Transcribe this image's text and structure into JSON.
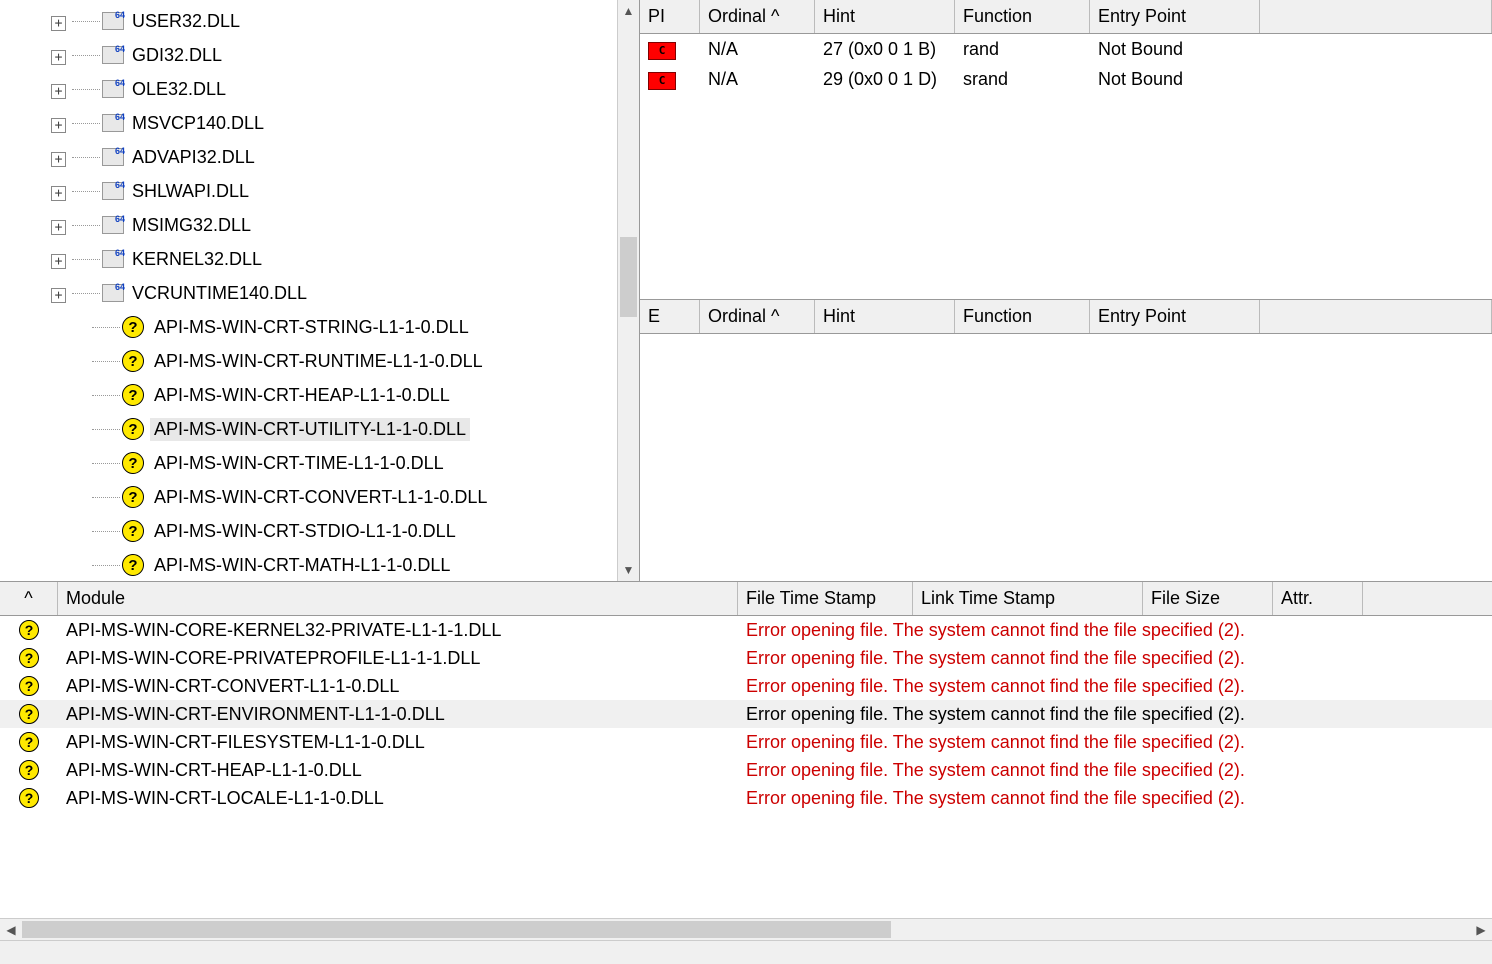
{
  "tree": {
    "nodes": [
      {
        "type": "mod",
        "label": "USER32.DLL",
        "expandable": true,
        "indent": 1
      },
      {
        "type": "mod",
        "label": "GDI32.DLL",
        "expandable": true,
        "indent": 1
      },
      {
        "type": "mod",
        "label": "OLE32.DLL",
        "expandable": true,
        "indent": 1
      },
      {
        "type": "mod",
        "label": "MSVCP140.DLL",
        "expandable": true,
        "indent": 1
      },
      {
        "type": "mod",
        "label": "ADVAPI32.DLL",
        "expandable": true,
        "indent": 1
      },
      {
        "type": "mod",
        "label": "SHLWAPI.DLL",
        "expandable": true,
        "indent": 1
      },
      {
        "type": "mod",
        "label": "MSIMG32.DLL",
        "expandable": true,
        "indent": 1
      },
      {
        "type": "mod",
        "label": "KERNEL32.DLL",
        "expandable": true,
        "indent": 1
      },
      {
        "type": "mod",
        "label": "VCRUNTIME140.DLL",
        "expandable": true,
        "indent": 1
      },
      {
        "type": "q",
        "label": "API-MS-WIN-CRT-STRING-L1-1-0.DLL",
        "indent": 2
      },
      {
        "type": "q",
        "label": "API-MS-WIN-CRT-RUNTIME-L1-1-0.DLL",
        "indent": 2
      },
      {
        "type": "q",
        "label": "API-MS-WIN-CRT-HEAP-L1-1-0.DLL",
        "indent": 2
      },
      {
        "type": "q",
        "label": "API-MS-WIN-CRT-UTILITY-L1-1-0.DLL",
        "indent": 2,
        "selected": true
      },
      {
        "type": "q",
        "label": "API-MS-WIN-CRT-TIME-L1-1-0.DLL",
        "indent": 2
      },
      {
        "type": "q",
        "label": "API-MS-WIN-CRT-CONVERT-L1-1-0.DLL",
        "indent": 2
      },
      {
        "type": "q",
        "label": "API-MS-WIN-CRT-STDIO-L1-1-0.DLL",
        "indent": 2
      },
      {
        "type": "q",
        "label": "API-MS-WIN-CRT-MATH-L1-1-0.DLL",
        "indent": 2,
        "last": true
      }
    ]
  },
  "imports": {
    "headers": [
      "PI",
      "Ordinal ^",
      "Hint",
      "Function",
      "Entry Point",
      ""
    ],
    "rows": [
      {
        "badge": "C",
        "ordinal": "N/A",
        "hint": "27 (0x0 0 1 B)",
        "func": "rand",
        "entry": "Not Bound"
      },
      {
        "badge": "C",
        "ordinal": "N/A",
        "hint": "29 (0x0 0 1 D)",
        "func": "srand",
        "entry": "Not Bound"
      }
    ]
  },
  "exports": {
    "headers": [
      "E",
      "Ordinal ^",
      "Hint",
      "Function",
      "Entry Point",
      ""
    ]
  },
  "modules": {
    "headers": [
      "^",
      "Module",
      "File Time Stamp",
      "Link Time Stamp",
      "File Size",
      "Attr."
    ],
    "error_text": "Error opening file. The system cannot find the file specified (2).",
    "rows": [
      {
        "name": "API-MS-WIN-CORE-KERNEL32-PRIVATE-L1-1-1.DLL"
      },
      {
        "name": "API-MS-WIN-CORE-PRIVATEPROFILE-L1-1-1.DLL"
      },
      {
        "name": "API-MS-WIN-CRT-CONVERT-L1-1-0.DLL"
      },
      {
        "name": "API-MS-WIN-CRT-ENVIRONMENT-L1-1-0.DLL",
        "selected": true
      },
      {
        "name": "API-MS-WIN-CRT-FILESYSTEM-L1-1-0.DLL"
      },
      {
        "name": "API-MS-WIN-CRT-HEAP-L1-1-0.DLL"
      },
      {
        "name": "API-MS-WIN-CRT-LOCALE-L1-1-0.DLL"
      }
    ]
  }
}
